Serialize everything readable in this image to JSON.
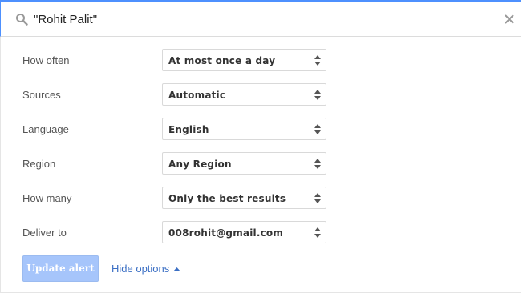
{
  "search": {
    "query": "\"Rohit Palit\""
  },
  "options": [
    {
      "label": "How often",
      "value": "At most once a day"
    },
    {
      "label": "Sources",
      "value": "Automatic"
    },
    {
      "label": "Language",
      "value": "English"
    },
    {
      "label": "Region",
      "value": "Any Region"
    },
    {
      "label": "How many",
      "value": "Only the best results"
    },
    {
      "label": "Deliver to",
      "value": "008rohit@gmail.com"
    }
  ],
  "actions": {
    "update_label": "Update alert",
    "hide_options_label": "Hide options"
  },
  "colors": {
    "focus_border": "#4d90fe",
    "button_disabled_bg": "#a6c5fb",
    "link": "#3b6fc4"
  },
  "icons": [
    "search-icon",
    "close-icon",
    "updown-arrows-icon",
    "caret-up-icon"
  ]
}
